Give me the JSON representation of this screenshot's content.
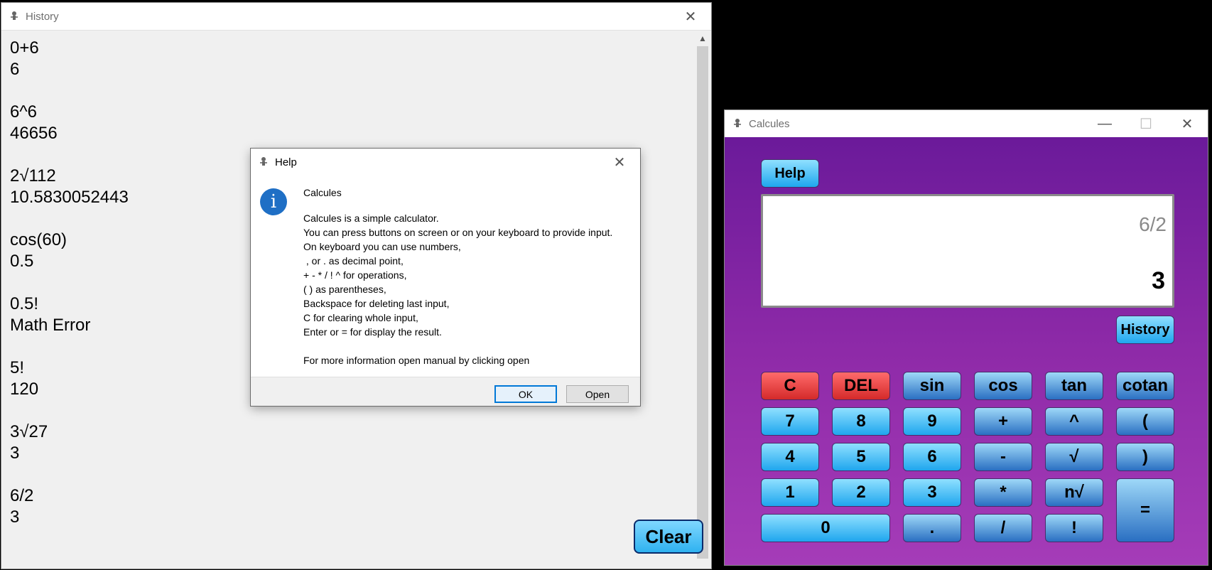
{
  "history_window": {
    "title": "History",
    "close_icon": "close-icon",
    "text": "0+6\n6\n\n6^6\n46656\n\n2√112\n10.5830052443\n\ncos(60)\n0.5\n\n0.5!\nMath Error\n\n5!\n120\n\n3√27\n3\n\n6/2\n3",
    "clear_label": "Clear"
  },
  "help_dialog": {
    "title": "Help",
    "heading": "Calcules",
    "message": "Calcules is a simple calculator.\nYou can press buttons on screen or on your keyboard to provide input.\nOn keyboard you can use numbers,\n , or . as decimal point,\n+ - * / ! ^ for operations,\n( ) as parentheses,\nBackspace for deleting last input,\nC for clearing whole input,\nEnter or = for display the result.\n\nFor more information open manual by clicking open",
    "ok_label": "OK",
    "open_label": "Open"
  },
  "calc_window": {
    "title": "Calcules",
    "help_label": "Help",
    "history_label": "History",
    "display": {
      "expression": "6/2",
      "result": "3"
    },
    "colors": {
      "background_top": "#6b1a9a",
      "background_bottom": "#a53cb8",
      "button_light": "#1fa6ee",
      "button_dark": "#2a6fc2",
      "button_red": "#d42a2a"
    },
    "keys": {
      "clear": "C",
      "delete": "DEL",
      "sin": "sin",
      "cos": "cos",
      "tan": "tan",
      "cotan": "cotan",
      "seven": "7",
      "eight": "8",
      "nine": "9",
      "plus": "+",
      "power": "^",
      "open_paren": "(",
      "four": "4",
      "five": "5",
      "six": "6",
      "minus": "-",
      "sqrt": "√",
      "close_paren": ")",
      "one": "1",
      "two": "2",
      "three": "3",
      "multiply": "*",
      "nth_root": "n√",
      "equals": "=",
      "zero": "0",
      "decimal": ".",
      "divide": "/",
      "factorial": "!"
    }
  }
}
